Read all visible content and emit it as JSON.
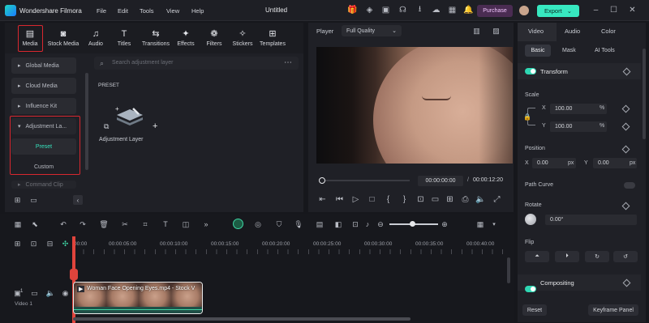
{
  "app": {
    "name": "Wondershare Filmora",
    "project_title": "Untitled"
  },
  "menu": [
    "File",
    "Edit",
    "Tools",
    "View",
    "Help"
  ],
  "header": {
    "purchase_label": "Purchase",
    "export_label": "Export"
  },
  "media_tabs": [
    {
      "label": "Media",
      "icon": "media-folder-icon"
    },
    {
      "label": "Stock Media",
      "icon": "stock-media-icon"
    },
    {
      "label": "Audio",
      "icon": "music-note-icon"
    },
    {
      "label": "Titles",
      "icon": "text-title-icon"
    },
    {
      "label": "Transitions",
      "icon": "transition-arrows-icon"
    },
    {
      "label": "Effects",
      "icon": "sparkle-effects-icon"
    },
    {
      "label": "Filters",
      "icon": "filters-circles-icon"
    },
    {
      "label": "Stickers",
      "icon": "sticker-icon"
    },
    {
      "label": "Templates",
      "icon": "template-grid-icon"
    }
  ],
  "sidebar": {
    "items": [
      "Global Media",
      "Cloud Media",
      "Influence Kit",
      "Adjustment La...",
      "Preset",
      "Custom",
      "Command Clip"
    ]
  },
  "library": {
    "search_placeholder": "Search adjustment layer",
    "section": "PRESET",
    "item_label": "Adjustment Layer"
  },
  "player": {
    "label": "Player",
    "quality": "Full Quality",
    "current_time": "00:00:00:00",
    "separator": "/",
    "total_time": "00:00:12:20"
  },
  "right_panel": {
    "tabs": [
      "Video",
      "Audio",
      "Color"
    ],
    "subtabs": [
      "Basic",
      "Mask",
      "AI Tools"
    ],
    "transform_label": "Transform",
    "scale_label": "Scale",
    "scale_x": "100.00",
    "scale_y": "100.00",
    "percent": "%",
    "x_label": "X",
    "y_label": "Y",
    "position_label": "Position",
    "pos_x": "0.00",
    "pos_y": "0.00",
    "px": "px",
    "path_curve_label": "Path Curve",
    "rotate_label": "Rotate",
    "rotate_value": "0.00°",
    "flip_label": "Flip",
    "compositing_label": "Compositing",
    "reset_label": "Reset",
    "keyframe_label": "Keyframe Panel"
  },
  "timeline": {
    "ruler": [
      "00:00",
      "00:00:05:00",
      "00:00:10:00",
      "00:00:15:00",
      "00:00:20:00",
      "00:00:25:00",
      "00:00:30:00",
      "00:00:35:00",
      "00:00:40:00"
    ],
    "clip_title": "Woman Face Opening Eyes.mp4 - Stock V",
    "track_label": "Video 1",
    "track_number": "1"
  }
}
